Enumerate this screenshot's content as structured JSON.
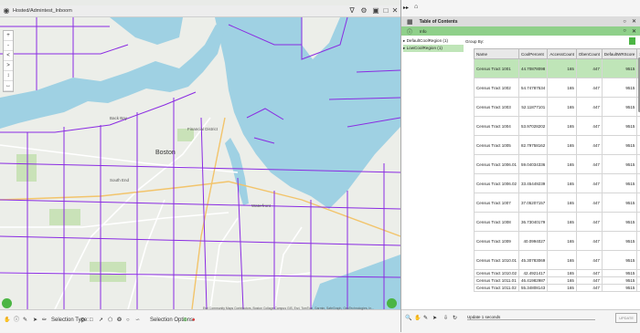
{
  "map": {
    "title": "Hosted/Admintest_Inboom",
    "labels": {
      "city": "Boston",
      "district": "Financial District",
      "waterfront": "Waterfront",
      "back_bay": "Back Bay",
      "south_end": "South End"
    },
    "left_tools": [
      "+",
      "-",
      "<",
      ">",
      "↕",
      "↔"
    ],
    "bottom": {
      "selection_type_label": "Selection Type:",
      "selection_options_label": "Selection Options:",
      "attribution": "Esri Community Maps Contributors, Boston Collage Campus GIS, Esri, TomTom, Garmin, SafeGraph, GeoTechnologies, In..."
    }
  },
  "colors": {
    "accent_green": "#4bb543",
    "selected_row": "#bfe5b8",
    "tract_line": "#8a2be2",
    "water": "#9fd1e3",
    "map_land": "#eceee9"
  },
  "icons": {
    "title": "globe-icon",
    "filter": "filter-icon",
    "settings": "settings-icon",
    "layers": "layers-icon",
    "close": "close-icon",
    "table": "table-icon",
    "edit": "pencil-icon",
    "locate": "compass-icon"
  },
  "panel": {
    "top_icons": [
      "▸▸",
      "⌂"
    ],
    "header_title": "Table of Contents",
    "sub_title": "Info",
    "tree": [
      "DefaultCoolRegion (1)",
      "LowCoolRegion (1)"
    ],
    "group_by_label": "Group By:",
    "columns": [
      "Name",
      "CoolPercent",
      "AccessCount",
      "ObenCount",
      "DefaultWRScore",
      "Se"
    ],
    "rows": [
      {
        "name": "Census Tract 1001",
        "cool": "44.70878098",
        "access": "165",
        "oben": "447",
        "score": "9515",
        "selected": true,
        "short": false
      },
      {
        "name": "Census Tract 1002",
        "cool": "54.74787534",
        "access": "165",
        "oben": "447",
        "score": "9515",
        "selected": false,
        "short": false
      },
      {
        "name": "Census Tract 1003",
        "cool": "52.11877101",
        "access": "165",
        "oben": "447",
        "score": "9515",
        "selected": false,
        "short": false
      },
      {
        "name": "Census Tract 1004",
        "cool": "53.97028202",
        "access": "165",
        "oben": "447",
        "score": "9515",
        "selected": false,
        "short": false
      },
      {
        "name": "Census Tract 1005",
        "cool": "82.79758162",
        "access": "165",
        "oben": "447",
        "score": "9515",
        "selected": false,
        "short": false
      },
      {
        "name": "Census Tract 1006.01",
        "cool": "59.04034336",
        "access": "165",
        "oben": "447",
        "score": "9515",
        "selected": false,
        "short": false
      },
      {
        "name": "Census Tract 1006.02",
        "cool": "33.45449239",
        "access": "165",
        "oben": "447",
        "score": "9515",
        "selected": false,
        "short": false
      },
      {
        "name": "Census Tract 1007",
        "cool": "37.05207157",
        "access": "165",
        "oben": "447",
        "score": "9515",
        "selected": false,
        "short": false
      },
      {
        "name": "Census Tract 1008",
        "cool": "36.73040179",
        "access": "165",
        "oben": "447",
        "score": "9515",
        "selected": false,
        "short": false
      },
      {
        "name": "Census Tract 1009",
        "cool": "40.0994027",
        "access": "165",
        "oben": "447",
        "score": "9515",
        "selected": false,
        "short": false
      },
      {
        "name": "Census Tract 1010.01",
        "cool": "45.30783069",
        "access": "165",
        "oben": "447",
        "score": "9515",
        "selected": false,
        "short": false
      },
      {
        "name": "Census Tract 1010.02",
        "cool": "42.4921417",
        "access": "165",
        "oben": "447",
        "score": "9515",
        "selected": false,
        "short": true
      },
      {
        "name": "Census Tract 1011.01",
        "cool": "46.41982987",
        "access": "165",
        "oben": "447",
        "score": "9515",
        "selected": false,
        "short": true
      },
      {
        "name": "Census Tract 1011.02",
        "cool": "55.34808143",
        "access": "165",
        "oben": "447",
        "score": "9515",
        "selected": false,
        "short": true
      }
    ],
    "refresh_label": "Update 1 seconds",
    "update_button": "UPDATE"
  }
}
